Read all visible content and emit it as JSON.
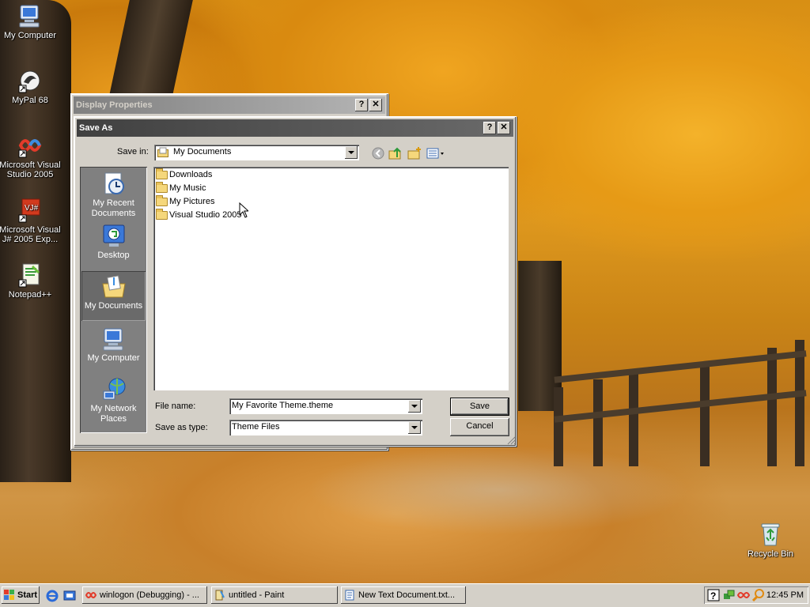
{
  "desktop": {
    "icons": [
      {
        "label": "My Computer"
      },
      {
        "label": "MyPal 68"
      },
      {
        "label": "Microsoft Visual Studio 2005"
      },
      {
        "label": "Microsoft Visual J# 2005 Exp..."
      },
      {
        "label": "Notepad++"
      },
      {
        "label": "Recycle Bin"
      }
    ]
  },
  "display_properties": {
    "title": "Display Properties",
    "help_button": "?",
    "close_button": "✕"
  },
  "save_as": {
    "title": "Save As",
    "help_button": "?",
    "close_button": "✕",
    "save_in_label": "Save in:",
    "save_in_value": "My Documents",
    "places": [
      {
        "label": "My Recent Documents",
        "icon": "recent-documents-icon"
      },
      {
        "label": "Desktop",
        "icon": "desktop-icon"
      },
      {
        "label": "My Documents",
        "icon": "my-documents-icon",
        "selected": true
      },
      {
        "label": "My Computer",
        "icon": "my-computer-icon"
      },
      {
        "label": "My Network Places",
        "icon": "network-places-icon"
      }
    ],
    "files": [
      {
        "name": "Downloads",
        "icon": "folder-icon"
      },
      {
        "name": "My Music",
        "icon": "folder-icon"
      },
      {
        "name": "My Pictures",
        "icon": "folder-icon"
      },
      {
        "name": "Visual Studio 2005",
        "icon": "folder-icon"
      }
    ],
    "file_name_label": "File name:",
    "file_name_value": "My Favorite Theme.theme",
    "save_type_label": "Save as type:",
    "save_type_value": "Theme Files",
    "save_button": "Save",
    "cancel_button": "Cancel"
  },
  "taskbar": {
    "start_label": "Start",
    "tasks": [
      {
        "label": "winlogon (Debugging) - ..."
      },
      {
        "label": "untitled - Paint"
      },
      {
        "label": "New Text Document.txt..."
      }
    ],
    "clock": "12:45 PM"
  }
}
